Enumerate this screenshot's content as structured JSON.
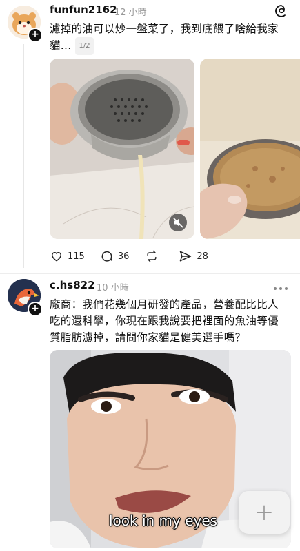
{
  "post1": {
    "username": "funfun2162",
    "time": "12 小時",
    "text_line1": "濾掉的油可以炒一盤菜了，我到底餵了啥給我家",
    "text_line2": "貓...",
    "page_indicator": "1/2",
    "likes": "115",
    "comments": "36",
    "shares": "28"
  },
  "post2": {
    "username": "c.hs822",
    "time": "10 小時",
    "text_line1": "廠商：我們花幾個月研發的產品，營養配比比人",
    "text_line2": "吃的還科學，你現在跟我說要把裡面的魚油等優",
    "text_line3": "質脂肪濾掉，請問你家貓是健美選手嗎？",
    "video_caption": "look in my eyes"
  },
  "fab": {
    "icon": "+"
  },
  "icons": [
    "threads-logo-icon",
    "heart-icon",
    "comment-icon",
    "repost-icon",
    "share-icon",
    "mute-icon",
    "more-icon",
    "plus-icon"
  ]
}
